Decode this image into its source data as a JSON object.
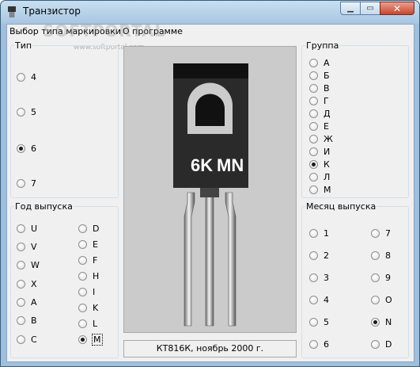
{
  "window": {
    "title": "Транзистор"
  },
  "menu": {
    "items": [
      "Выбор типа маркировки",
      "О программе"
    ]
  },
  "watermark": {
    "text": "SOFTPORTAL",
    "url": "www.softportal.com"
  },
  "type_group": {
    "label": "Тип",
    "options": [
      "4",
      "5",
      "6",
      "7"
    ],
    "selected": "6"
  },
  "group_group": {
    "label": "Группа",
    "options": [
      "А",
      "Б",
      "В",
      "Г",
      "Д",
      "Е",
      "Ж",
      "И",
      "К",
      "Л",
      "М"
    ],
    "selected": "К"
  },
  "year_group": {
    "label": "Год выпуска",
    "col1": [
      "U",
      "V",
      "W",
      "X",
      "A",
      "B",
      "C"
    ],
    "col2": [
      "D",
      "E",
      "F",
      "H",
      "I",
      "K",
      "L",
      "M"
    ],
    "selected": "M"
  },
  "month_group": {
    "label": "Месяц выпуска",
    "col1": [
      "1",
      "2",
      "3",
      "4",
      "5",
      "6"
    ],
    "col2": [
      "7",
      "8",
      "9",
      "O",
      "N",
      "D"
    ],
    "selected": "N"
  },
  "transistor": {
    "mark_left": "6K",
    "mark_right": "MN"
  },
  "status": {
    "text": "КТ816К, ноябрь 2000 г."
  }
}
